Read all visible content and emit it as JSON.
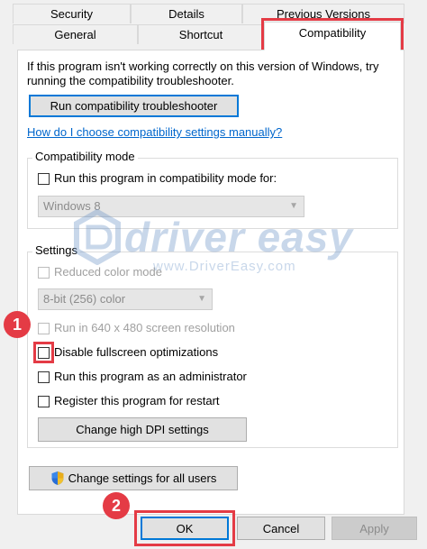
{
  "tabs": {
    "security": "Security",
    "details": "Details",
    "previous_versions": "Previous Versions",
    "general": "General",
    "shortcut": "Shortcut",
    "compatibility": "Compatibility"
  },
  "intro_text_1": "If this program isn't working correctly on this version of Windows, try",
  "intro_text_2": "running the compatibility troubleshooter.",
  "run_troubleshooter_label": "Run compatibility troubleshooter",
  "help_link": "How do I choose compatibility settings manually?",
  "compat_mode": {
    "legend": "Compatibility mode",
    "checkbox_label": "Run this program in compatibility mode for:",
    "selected": "Windows 8"
  },
  "settings": {
    "legend": "Settings",
    "reduced_color": "Reduced color mode",
    "color_selected": "8-bit (256) color",
    "run_640": "Run in 640 x 480 screen resolution",
    "disable_fullscreen": "Disable fullscreen optimizations",
    "run_admin": "Run this program as an administrator",
    "register_restart": "Register this program for restart",
    "high_dpi_label": "Change high DPI settings"
  },
  "change_all_users_label": "Change settings for all users",
  "footer": {
    "ok": "OK",
    "cancel": "Cancel",
    "apply": "Apply"
  },
  "annotations": {
    "step1": "1",
    "step2": "2"
  },
  "watermark": {
    "brand": "driver easy",
    "url": "www.DriverEasy.com"
  },
  "colors": {
    "highlight_red": "#e43b45",
    "link_blue": "#0066cc",
    "default_button_border": "#0078d7"
  }
}
